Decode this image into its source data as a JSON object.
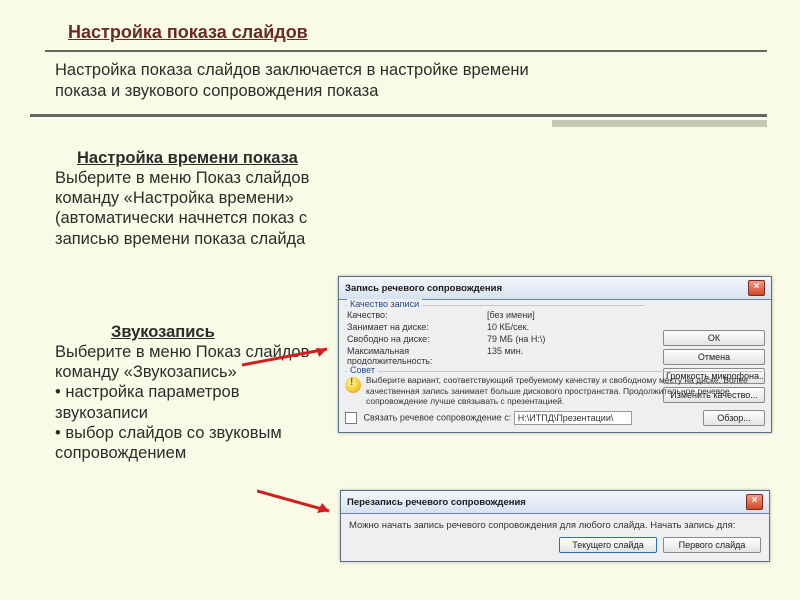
{
  "title": "Настройка показа слайдов",
  "intro": "Настройка показа слайдов заключается в настройке времени показа и звукового сопровождения показа",
  "section1": {
    "heading": "Настройка времени показа",
    "body": "Выберите в меню Показ слайдов команду «Настройка времени» (автоматически начнется показ с записью времени показа слайда"
  },
  "section2": {
    "heading": "Звукозапись",
    "body": "Выберите в меню Показ слайдов команду «Звукозапись»",
    "bullets": [
      "• настройка параметров звукозаписи",
      "• выбор слайдов со звуковым сопровождением"
    ]
  },
  "dialog1": {
    "title": "Запись речевого сопровождения",
    "group_quality": "Качество записи",
    "rows": [
      {
        "k": "Качество:",
        "v": "[без имени]"
      },
      {
        "k": "Занимает на диске:",
        "v": "10 КБ/сек."
      },
      {
        "k": "Свободно на диске:",
        "v": "79 МБ (на Н:\\)"
      },
      {
        "k": "Максимальная продолжительность:",
        "v": "135 мин."
      }
    ],
    "buttons": {
      "ok": "ОК",
      "cancel": "Отмена",
      "mic": "Громкость микрофона...",
      "quality": "Изменить качество..."
    },
    "tip_label": "Совет",
    "tip_text": "Выберите вариант, соответствующий требуемому качеству и свободному месту на диске. Более качественная запись занимает больше дискового пространства. Продолжительное речевое сопровождение лучше связывать с презентацией.",
    "link_checkbox": "Связать речевое сопровождение с:",
    "link_path": "Н:\\ИТПД\\Презентации\\",
    "browse": "Обзор..."
  },
  "dialog2": {
    "title": "Перезапись речевого сопровождения",
    "body": "Можно начать запись речевого сопровождения для любого слайда. Начать запись для:",
    "btn_current": "Текущего слайда",
    "btn_first": "Первого слайда"
  }
}
